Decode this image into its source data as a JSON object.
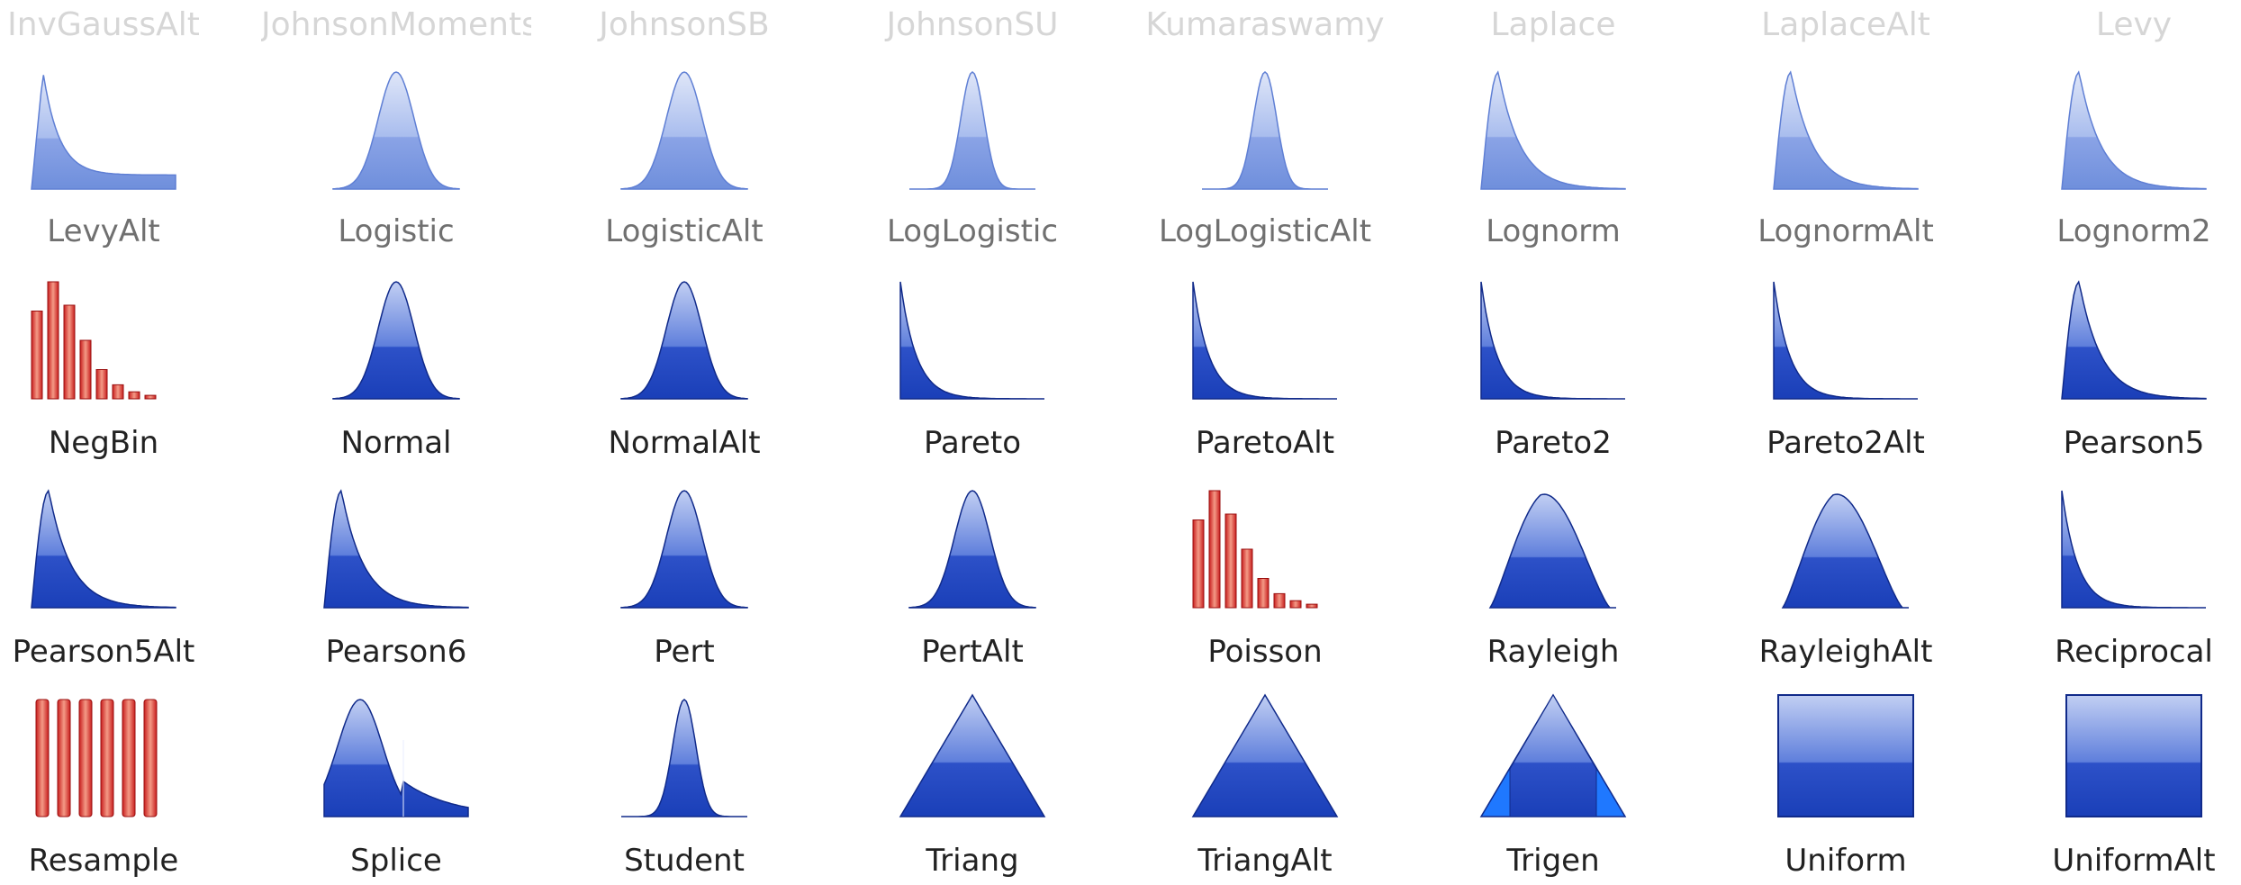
{
  "header_labels": [
    "InvGaussAlt",
    "JohnsonMoments",
    "JohnsonSB",
    "JohnsonSU",
    "Kumaraswamy",
    "Laplace",
    "LaplaceAlt",
    "Levy"
  ],
  "rows": [
    {
      "style": "faded",
      "items": [
        {
          "label": "LevyAlt",
          "icon": "long-tail-icon"
        },
        {
          "label": "Logistic",
          "icon": "bell-curve-icon"
        },
        {
          "label": "LogisticAlt",
          "icon": "bell-curve-icon"
        },
        {
          "label": "LogLogistic",
          "icon": "peak-curve-icon"
        },
        {
          "label": "LogLogisticAlt",
          "icon": "peak-curve-icon"
        },
        {
          "label": "Lognorm",
          "icon": "right-skew-curve-icon"
        },
        {
          "label": "LognormAlt",
          "icon": "right-skew-curve-icon"
        },
        {
          "label": "Lognorm2",
          "icon": "right-skew-curve-icon"
        }
      ]
    },
    {
      "style": "dark",
      "items": [
        {
          "label": "NegBin",
          "icon": "discrete-bars-icon"
        },
        {
          "label": "Normal",
          "icon": "bell-curve-icon"
        },
        {
          "label": "NormalAlt",
          "icon": "bell-curve-icon"
        },
        {
          "label": "Pareto",
          "icon": "decay-curve-icon"
        },
        {
          "label": "ParetoAlt",
          "icon": "decay-curve-icon"
        },
        {
          "label": "Pareto2",
          "icon": "decay-curve-icon"
        },
        {
          "label": "Pareto2Alt",
          "icon": "decay-curve-icon"
        },
        {
          "label": "Pearson5",
          "icon": "right-skew-curve-icon"
        }
      ]
    },
    {
      "style": "dark",
      "items": [
        {
          "label": "Pearson5Alt",
          "icon": "right-skew-curve-icon"
        },
        {
          "label": "Pearson6",
          "icon": "right-skew-curve-icon"
        },
        {
          "label": "Pert",
          "icon": "bell-curve-icon"
        },
        {
          "label": "PertAlt",
          "icon": "bell-curve-icon"
        },
        {
          "label": "Poisson",
          "icon": "discrete-bars-icon"
        },
        {
          "label": "Rayleigh",
          "icon": "skewed-hump-curve-icon"
        },
        {
          "label": "RayleighAlt",
          "icon": "skewed-hump-curve-icon"
        },
        {
          "label": "Reciprocal",
          "icon": "decay-curve-icon"
        }
      ]
    },
    {
      "style": "dark",
      "items": [
        {
          "label": "Resample",
          "icon": "equal-bars-icon"
        },
        {
          "label": "Splice",
          "icon": "splice-curve-icon"
        },
        {
          "label": "Student",
          "icon": "peak-curve-icon"
        },
        {
          "label": "Triang",
          "icon": "triangle-icon"
        },
        {
          "label": "TriangAlt",
          "icon": "triangle-icon"
        },
        {
          "label": "Trigen",
          "icon": "trigen-triangle-icon"
        },
        {
          "label": "Uniform",
          "icon": "uniform-block-icon"
        },
        {
          "label": "UniformAlt",
          "icon": "uniform-block-icon"
        }
      ]
    }
  ],
  "colors": {
    "curve_faded_top": "#dfe6f8",
    "curve_faded_bottom": "#6f8fdc",
    "curve_dark_top": "#c2cff3",
    "curve_dark_bottom": "#1a3fb8",
    "bar_red": "#c81e1e",
    "bar_red_light": "#f49a86",
    "trigen_side": "#1f78ff",
    "top_label": "#d6d6d6"
  }
}
